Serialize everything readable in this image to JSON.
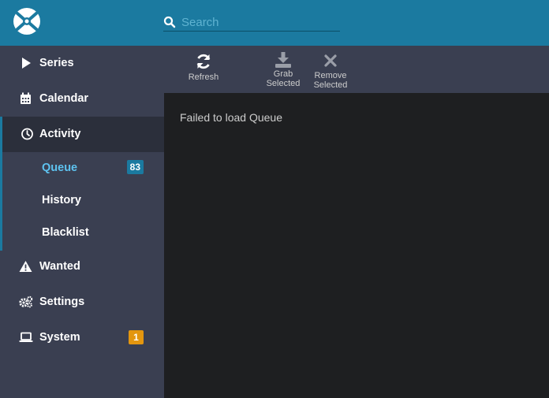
{
  "search": {
    "placeholder": "Search"
  },
  "sidebar": {
    "items": [
      {
        "label": "Series",
        "icon": "play-icon"
      },
      {
        "label": "Calendar",
        "icon": "calendar-icon"
      },
      {
        "label": "Activity",
        "icon": "clock-icon"
      },
      {
        "label": "Wanted",
        "icon": "warning-icon"
      },
      {
        "label": "Settings",
        "icon": "cogs-icon"
      },
      {
        "label": "System",
        "icon": "laptop-icon",
        "badge": "1"
      }
    ],
    "activity_sub": [
      {
        "label": "Queue",
        "badge": "83"
      },
      {
        "label": "History"
      },
      {
        "label": "Blacklist"
      }
    ]
  },
  "toolbar": {
    "refresh": "Refresh",
    "grab_line1": "Grab",
    "grab_line2": "Selected",
    "remove_line1": "Remove",
    "remove_line2": "Selected"
  },
  "main": {
    "message": "Failed to load Queue"
  },
  "colors": {
    "header": "#1b7aa0",
    "sidebar": "#3a3f51",
    "content": "#1e1f21",
    "accent": "#5ec3f0",
    "warning": "#e3960f"
  }
}
